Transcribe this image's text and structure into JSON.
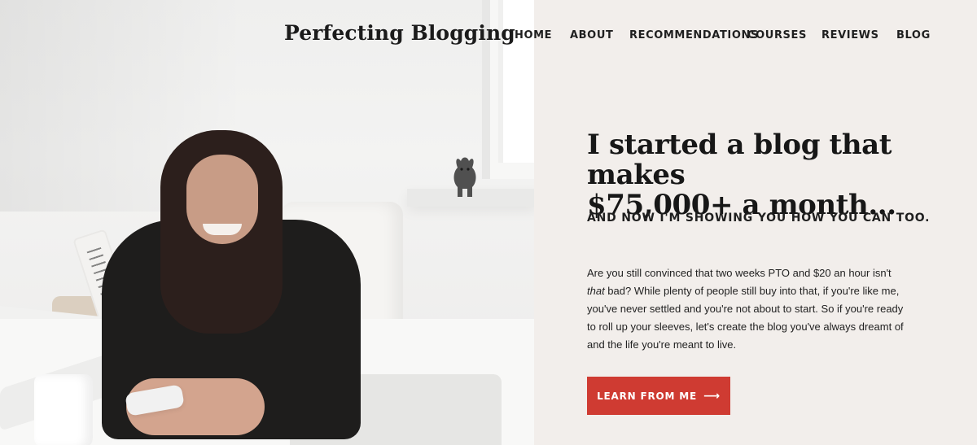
{
  "site": {
    "title": "Perfecting Blogging"
  },
  "nav": {
    "items": [
      {
        "label": "HOME"
      },
      {
        "label": "ABOUT"
      },
      {
        "label": "RECOMMENDATIONS"
      },
      {
        "label": "COURSES"
      },
      {
        "label": "REVIEWS"
      },
      {
        "label": "BLOG"
      }
    ]
  },
  "hero": {
    "title_line1": "I started a blog that makes",
    "title_line2": "$75,000+ a month...",
    "subheadline": "AND NOW I'M SHOWING YOU HOW YOU CAN TOO.",
    "copy_before_em": "Are you still convinced that two weeks PTO and $20 an hour isn't ",
    "copy_em": "that",
    "copy_after_em": " bad? While plenty of people still buy into that, if you're like me, you've never settled and you're not about to start. So if you're ready to roll up your sleeves, let's create the blog you've always dreamt of and the life you're meant to live.",
    "cta_label": "LEARN FROM ME",
    "cta_arrow": "⟶"
  },
  "colors": {
    "background": "#f2eeeb",
    "cta": "#cf3b32",
    "text": "#171717"
  },
  "icons": {
    "cta_arrow": "arrow-right-icon"
  }
}
